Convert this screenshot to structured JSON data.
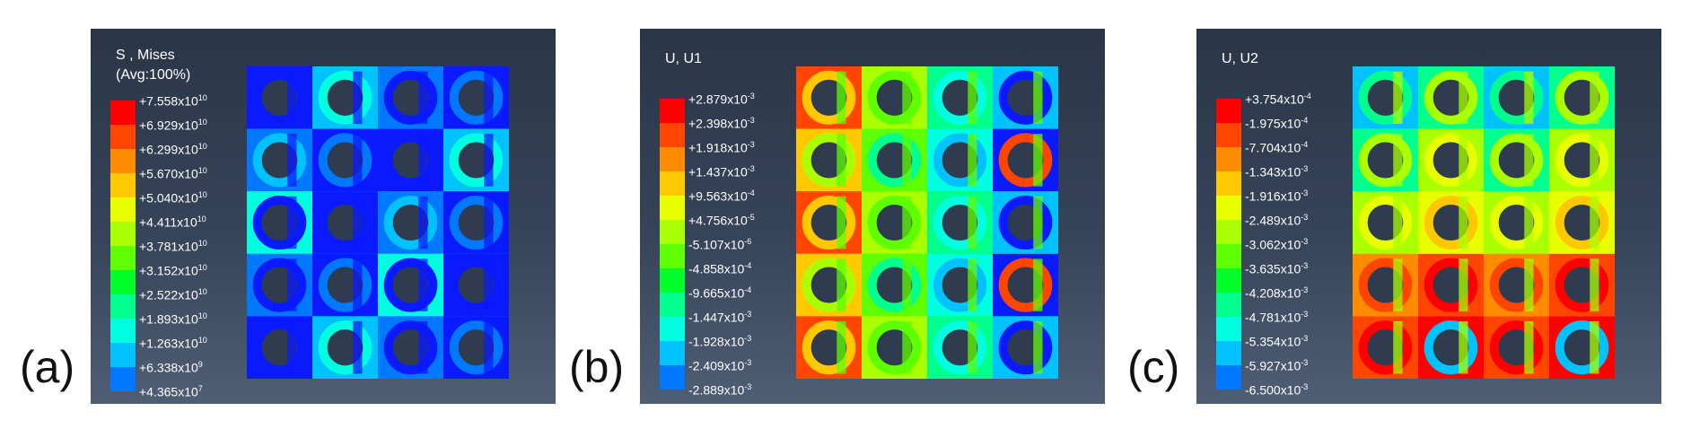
{
  "palette": [
    "#ff0000",
    "#ff4500",
    "#ff8c00",
    "#ffc800",
    "#e8ff00",
    "#aaff00",
    "#5eff00",
    "#00ff2a",
    "#00ff8c",
    "#00ffe0",
    "#00c2ff",
    "#0078ff",
    "#0a1aff"
  ],
  "panels": [
    {
      "tag": "(a)",
      "title1": "S , Mises",
      "title2": "(Avg:100%)",
      "ticks": [
        {
          "m": "+7.558",
          "e": "10"
        },
        {
          "m": "+6.929",
          "e": "10"
        },
        {
          "m": "+6.299",
          "e": "10"
        },
        {
          "m": "+5.670",
          "e": "10"
        },
        {
          "m": "+5.040",
          "e": "10"
        },
        {
          "m": "+4.411",
          "e": "10"
        },
        {
          "m": "+3.781",
          "e": "10"
        },
        {
          "m": "+3.152",
          "e": "10"
        },
        {
          "m": "+2.522",
          "e": "10"
        },
        {
          "m": "+1.893",
          "e": "10"
        },
        {
          "m": "+1.263",
          "e": "10"
        },
        {
          "m": "+6.338",
          "e": "9"
        },
        {
          "m": "+4.365",
          "e": "7"
        }
      ],
      "field": [
        "#0a1aff",
        "#0a1aff",
        "#0078ff",
        "#00c2ff",
        "#00ffe0",
        "#0a1aff",
        "#0078ff",
        "#0a1aff"
      ],
      "accent": "#0a1aff"
    },
    {
      "tag": "(b)",
      "title1": "U, U1",
      "title2": "",
      "ticks": [
        {
          "m": "+2.879",
          "e": "-3"
        },
        {
          "m": "+2.398",
          "e": "-3"
        },
        {
          "m": "+1.918",
          "e": "-3"
        },
        {
          "m": "+1.437",
          "e": "-3"
        },
        {
          "m": "+9.563",
          "e": "-4"
        },
        {
          "m": "+4.756",
          "e": "-5"
        },
        {
          "m": "-5.107",
          "e": "-6"
        },
        {
          "m": "-4.858",
          "e": "-4"
        },
        {
          "m": "-9.665",
          "e": "-4"
        },
        {
          "m": "-1.447",
          "e": "-3"
        },
        {
          "m": "-1.928",
          "e": "-3"
        },
        {
          "m": "-2.409",
          "e": "-3"
        },
        {
          "m": "-2.889",
          "e": "-3"
        }
      ],
      "field": [
        "#ff4500",
        "#ffc800",
        "#aaff00",
        "#5eff00",
        "#00ff8c",
        "#00ffe0",
        "#00c2ff",
        "#0a1aff"
      ],
      "accent": "#5eff00"
    },
    {
      "tag": "(c)",
      "title1": "U, U2",
      "title2": "",
      "ticks": [
        {
          "m": "+3.754",
          "e": "-4"
        },
        {
          "m": "-1.975",
          "e": "-4"
        },
        {
          "m": "-7.704",
          "e": "-4"
        },
        {
          "m": "-1.343",
          "e": "-3"
        },
        {
          "m": "-1.916",
          "e": "-3"
        },
        {
          "m": "-2.489",
          "e": "-3"
        },
        {
          "m": "-3.062",
          "e": "-3"
        },
        {
          "m": "-3.635",
          "e": "-3"
        },
        {
          "m": "-4.208",
          "e": "-3"
        },
        {
          "m": "-4.781",
          "e": "-3"
        },
        {
          "m": "-5.354",
          "e": "-3"
        },
        {
          "m": "-5.927",
          "e": "-3"
        },
        {
          "m": "-6.500",
          "e": "-3"
        }
      ],
      "field": [
        "#00c2ff",
        "#00ff8c",
        "#aaff00",
        "#e8ff00",
        "#ffc800",
        "#ff8c00",
        "#ff4500",
        "#ff0000"
      ],
      "accent": "#aaff00"
    }
  ]
}
